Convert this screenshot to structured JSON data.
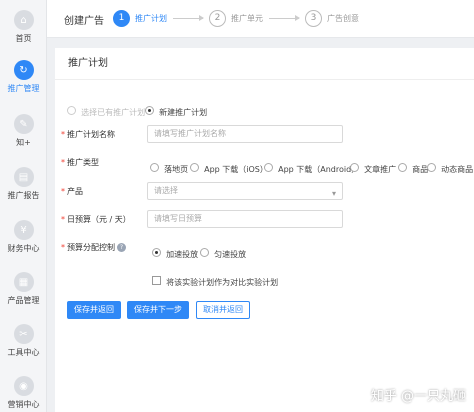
{
  "sidebar": {
    "items": [
      {
        "label": "首页",
        "icon": "home-icon",
        "glyph": "⌂"
      },
      {
        "label": "推广管理",
        "icon": "promotion-icon",
        "glyph": "↻"
      },
      {
        "label": "知+",
        "icon": "zhi-plus-icon",
        "glyph": "✎"
      },
      {
        "label": "推广报告",
        "icon": "report-icon",
        "glyph": "▤"
      },
      {
        "label": "财务中心",
        "icon": "finance-icon",
        "glyph": "¥"
      },
      {
        "label": "产品管理",
        "icon": "product-icon",
        "glyph": "▦"
      },
      {
        "label": "工具中心",
        "icon": "tools-icon",
        "glyph": "✂"
      },
      {
        "label": "营销中心",
        "icon": "marketing-icon",
        "glyph": "◉"
      }
    ],
    "active_index": 1
  },
  "topbar": {
    "title": "创建广告",
    "steps": [
      {
        "num": "1",
        "label": "推广计划"
      },
      {
        "num": "2",
        "label": "推广单元"
      },
      {
        "num": "3",
        "label": "广告创意"
      }
    ]
  },
  "panel": {
    "title": "推广计划",
    "plan_choice": {
      "existing": "选择已有推广计划",
      "new": "新建推广计划"
    },
    "fields": {
      "name": {
        "label": "推广计划名称",
        "placeholder": "请填写推广计划名称"
      },
      "type": {
        "label": "推广类型",
        "options": [
          "落地页",
          "App 下载（iOS）",
          "App 下载（Android）",
          "文章推广",
          "商品",
          "动态商品"
        ]
      },
      "product": {
        "label": "产品",
        "placeholder": "请选择"
      },
      "budget": {
        "label": "日预算（元 / 天）",
        "placeholder": "请填写日预算"
      },
      "pacing": {
        "label": "预算分配控制",
        "options": [
          "加速投放",
          "匀速投放"
        ],
        "experiment": "将该实验计划作为对比实验计划"
      }
    },
    "buttons": {
      "save_back": "保存并返回",
      "save_next": "保存并下一步",
      "cancel_back": "取消并返回"
    }
  },
  "watermark": "知乎 @一只丸砸",
  "colors": {
    "accent": "#2f88f6",
    "required": "#f04134"
  }
}
